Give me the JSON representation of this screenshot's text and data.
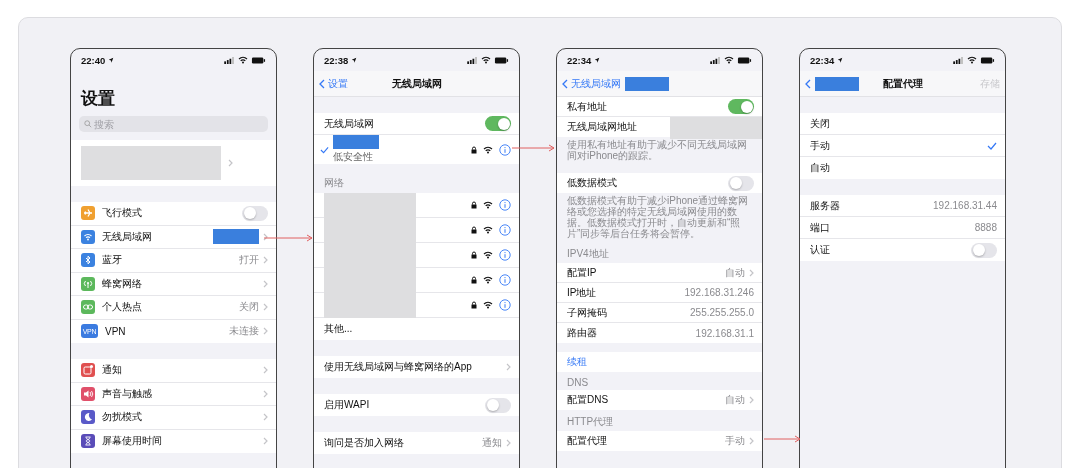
{
  "phones": [
    {
      "status": {
        "time": "22:40"
      },
      "large_title": "设置",
      "search": {
        "placeholder": "搜索"
      },
      "groups": [
        {
          "rows": [
            {
              "kind": "profile"
            }
          ]
        },
        {
          "rows": [
            {
              "kind": "toggle",
              "label": "飞行模式",
              "on": false,
              "color": "#f0a030"
            },
            {
              "kind": "detail",
              "label": "无线局域网",
              "redacted": true,
              "color": "#3b82e0"
            },
            {
              "kind": "detail",
              "label": "蓝牙",
              "value": "打开",
              "color": "#3b82e0"
            },
            {
              "kind": "detail",
              "label": "蜂窝网络",
              "color": "#5cb85c"
            },
            {
              "kind": "detail",
              "label": "个人热点",
              "value": "关闭",
              "color": "#5cb85c"
            },
            {
              "kind": "detail",
              "label": "VPN",
              "value": "未连接",
              "color": "#3b7be0",
              "badge": "VPN"
            }
          ]
        },
        {
          "rows": [
            {
              "kind": "detail",
              "label": "通知",
              "color": "#e05050"
            },
            {
              "kind": "detail",
              "label": "声音与触感",
              "color": "#e0506a"
            },
            {
              "kind": "detail",
              "label": "勿扰模式",
              "color": "#5a5ac8"
            },
            {
              "kind": "detail",
              "label": "屏幕使用时间",
              "color": "#5a4cb8"
            }
          ]
        }
      ]
    },
    {
      "status": {
        "time": "22:38"
      },
      "nav": {
        "back": "设置",
        "title": "无线局域网"
      },
      "groups": [
        {
          "rows": [
            {
              "kind": "toggle",
              "label": "无线局域网",
              "on": true
            },
            {
              "kind": "network",
              "selected": true,
              "note": "低安全性",
              "locked": true
            }
          ]
        },
        {
          "header": "网络",
          "rows": [
            {
              "kind": "network",
              "selected": false,
              "locked": true
            },
            {
              "kind": "network",
              "selected": false,
              "locked": true
            },
            {
              "kind": "network",
              "selected": false,
              "locked": true
            },
            {
              "kind": "network",
              "selected": false,
              "locked": true
            },
            {
              "kind": "network",
              "selected": false,
              "locked": true
            },
            {
              "kind": "plain",
              "label": "其他..."
            }
          ]
        },
        {
          "rows": [
            {
              "kind": "detail",
              "label": "使用无线局域网与蜂窝网络的App"
            }
          ]
        },
        {
          "rows": [
            {
              "kind": "toggle",
              "label": "启用WAPI",
              "on": false
            }
          ]
        },
        {
          "rows": [
            {
              "kind": "detail",
              "label": "询问是否加入网络",
              "value": "通知"
            }
          ]
        }
      ]
    },
    {
      "status": {
        "time": "22:34"
      },
      "nav": {
        "back": "无线局域网",
        "redacted": true
      },
      "groups": [
        {
          "rows": [
            {
              "kind": "toggle",
              "label": "私有地址",
              "on": true
            },
            {
              "kind": "plain",
              "label": "无线局域网地址",
              "redacted": true
            }
          ],
          "footer": "使用私有地址有助于减少不同无线局域网间对iPhone的跟踪。"
        },
        {
          "rows": [
            {
              "kind": "toggle",
              "label": "低数据模式",
              "on": false
            }
          ],
          "footer": "低数据模式有助于减少iPhone通过蜂窝网络或您选择的特定无线局域网使用的数据。低数据模式打开时，自动更新和“照片”同步等后台任务将会暂停。"
        },
        {
          "header": "IPV4地址",
          "rows": [
            {
              "kind": "detail",
              "label": "配置IP",
              "value": "自动"
            },
            {
              "kind": "plain",
              "label": "IP地址",
              "value": "192.168.31.246"
            },
            {
              "kind": "plain",
              "label": "子网掩码",
              "value": "255.255.255.0"
            },
            {
              "kind": "plain",
              "label": "路由器",
              "value": "192.168.31.1"
            }
          ]
        },
        {
          "rows": [
            {
              "kind": "link",
              "label": "续租"
            }
          ]
        },
        {
          "header": "DNS",
          "rows": [
            {
              "kind": "detail",
              "label": "配置DNS",
              "value": "自动"
            }
          ]
        },
        {
          "header": "HTTP代理",
          "rows": [
            {
              "kind": "detail",
              "label": "配置代理",
              "value": "手动"
            }
          ]
        }
      ]
    },
    {
      "status": {
        "time": "22:34"
      },
      "nav": {
        "redacted": true,
        "title": "配置代理",
        "action": "存储",
        "action_disabled": true
      },
      "groups": [
        {
          "rows": [
            {
              "kind": "option",
              "label": "关闭",
              "selected": false
            },
            {
              "kind": "option",
              "label": "手动",
              "selected": true
            },
            {
              "kind": "option",
              "label": "自动",
              "selected": false
            }
          ]
        },
        {
          "rows": [
            {
              "kind": "plain",
              "label": "服务器",
              "value": "192.168.31.44"
            },
            {
              "kind": "plain",
              "label": "端口",
              "value": "8888"
            },
            {
              "kind": "toggle",
              "label": "认证",
              "on": false
            }
          ]
        }
      ]
    }
  ]
}
